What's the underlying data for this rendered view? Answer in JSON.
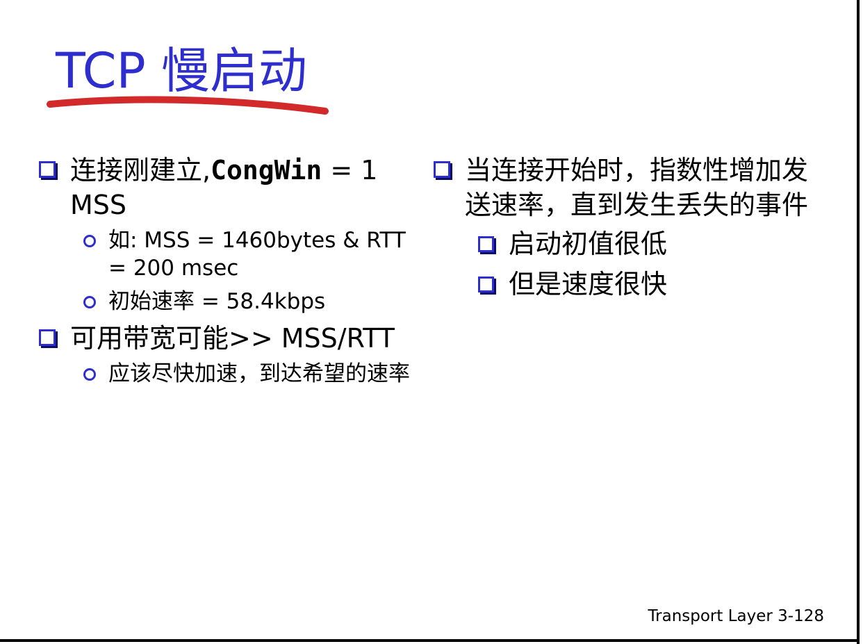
{
  "title": "TCP 慢启动",
  "left": {
    "b1_text": "连接刚建立,",
    "b1_code": "CongWin",
    "b1_rest": " = 1 MSS",
    "b1_subs": [
      "如: MSS = 1460bytes & RTT = 200 msec",
      "初始速率 = 58.4kbps"
    ],
    "b2_text": "可用带宽可能>> MSS/RTT",
    "b2_subs": [
      "应该尽快加速，到达希望的速率"
    ]
  },
  "right": {
    "b1_text": "当连接开始时，指数性增加发送速率，直到发生丢失的事件",
    "b1_subs": [
      "启动初值很低",
      "但是速度很快"
    ]
  },
  "footer": "Transport Layer 3-128",
  "colors": {
    "title": "#2e2ecf",
    "underline": "#d22a2a",
    "bullet": "#2e2ecf"
  }
}
